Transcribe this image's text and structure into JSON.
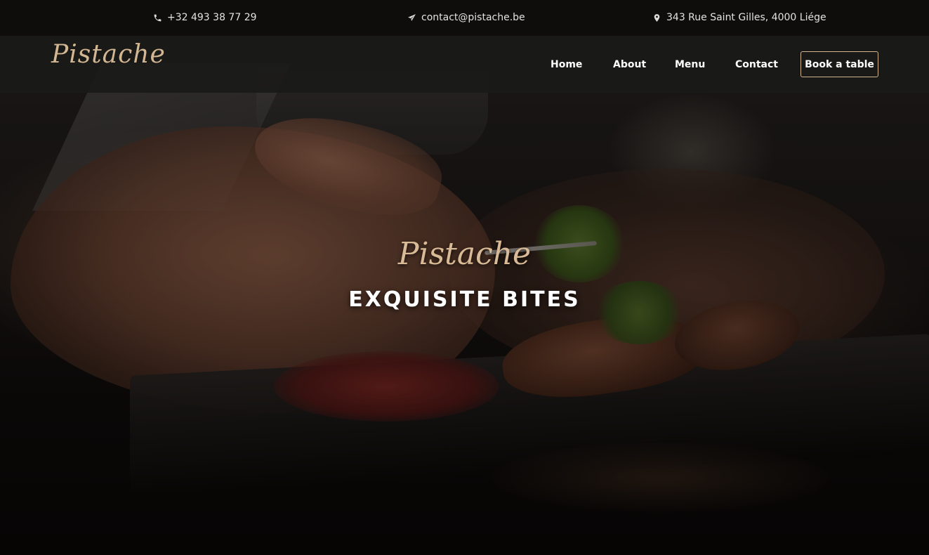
{
  "topbar": {
    "phone": "+32 493 38 77 29",
    "email": "contact@pistache.be",
    "address": "343 Rue Saint Gilles, 4000 Liége",
    "phone_icon": "phone-icon",
    "email_icon": "paper-plane-icon",
    "address_icon": "map-pin-icon"
  },
  "navbar": {
    "logo": "Pistache",
    "links": [
      {
        "label": "Home"
      },
      {
        "label": "About"
      },
      {
        "label": "Menu"
      },
      {
        "label": "Contact"
      }
    ],
    "cta_label": "Book a table"
  },
  "hero": {
    "script_title": "Pistache",
    "headline": "EXQUISITE BITES"
  },
  "colors": {
    "accent_gold": "#d3b692",
    "topbar_bg": "#0c0b0a",
    "navbar_bg": "#1a1918",
    "text_light": "#ffffff"
  }
}
